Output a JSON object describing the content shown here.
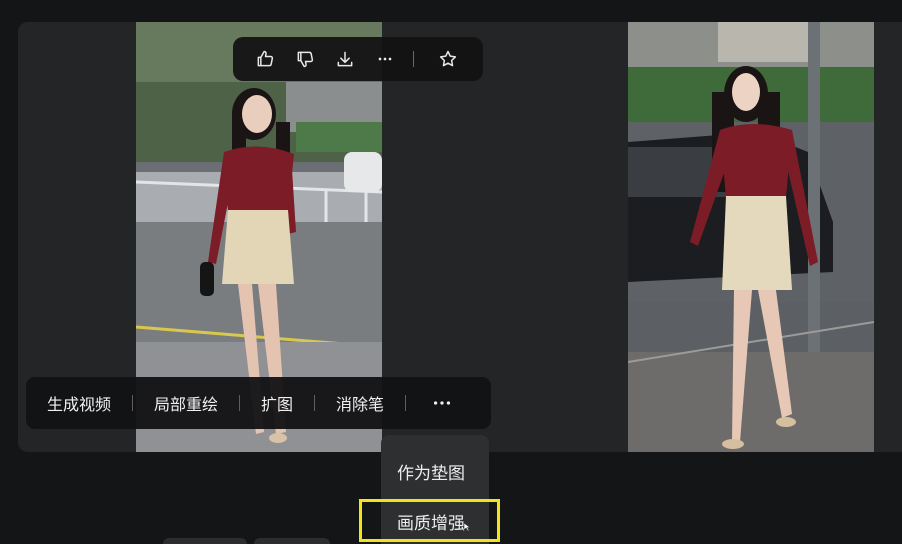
{
  "top_toolbar": {
    "icons": [
      "thumbs-up-icon",
      "thumbs-down-icon",
      "download-icon",
      "more-icon",
      "star-icon"
    ]
  },
  "action_bar": {
    "items": [
      "生成视频",
      "局部重绘",
      "扩图",
      "消除笔"
    ],
    "more_icon": "more-icon"
  },
  "dropdown": {
    "items": [
      "作为垫图",
      "画质增强"
    ],
    "highlighted_index": 1,
    "highlight_color": "#f3e31b"
  },
  "images": [
    {
      "name": "generated-image-1",
      "subject": "woman in burgundy top and cream skirt"
    },
    {
      "name": "generated-image-2",
      "subject": "woman in burgundy top and cream skirt"
    }
  ]
}
